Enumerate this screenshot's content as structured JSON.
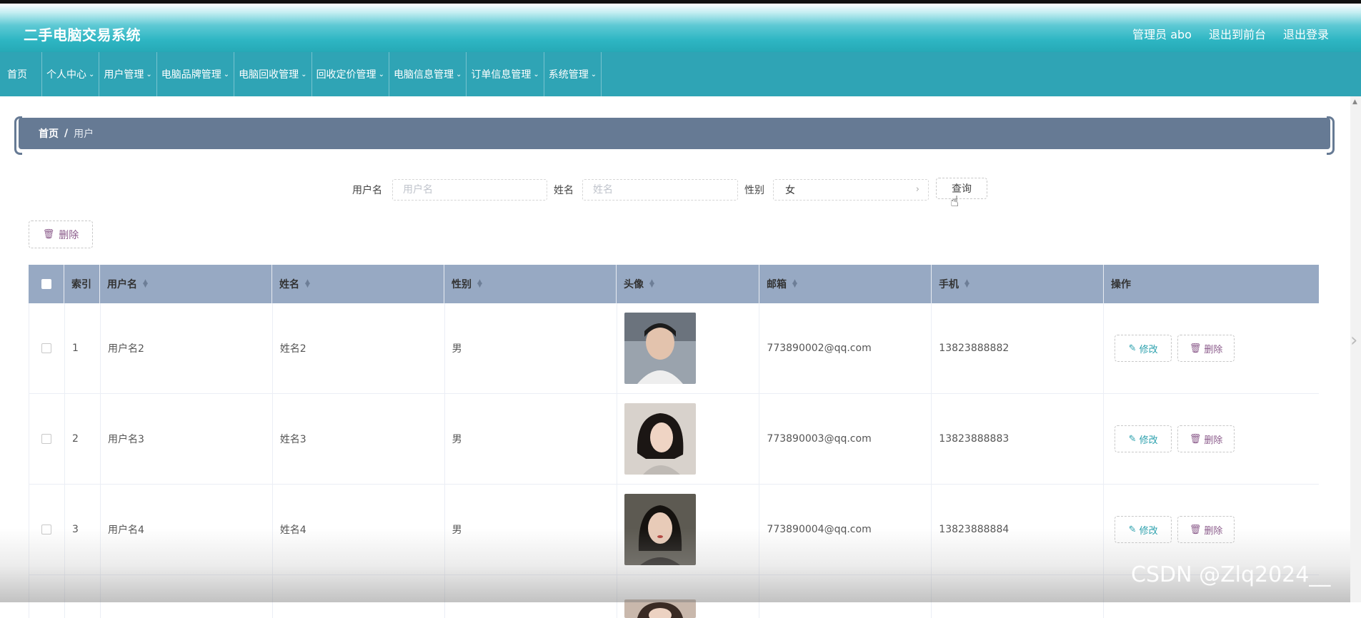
{
  "header": {
    "app_title": "二手电脑交易系统",
    "admin_label": "管理员 abo",
    "front_link": "退出到前台",
    "logout_link": "退出登录"
  },
  "nav": {
    "items": [
      {
        "label": "首页"
      },
      {
        "label": "个人中心"
      },
      {
        "label": "用户管理"
      },
      {
        "label": "电脑品牌管理"
      },
      {
        "label": "电脑回收管理"
      },
      {
        "label": "回收定价管理"
      },
      {
        "label": "电脑信息管理"
      },
      {
        "label": "订单信息管理"
      },
      {
        "label": "系统管理"
      }
    ]
  },
  "breadcrumb": {
    "home": "首页",
    "separator": "/",
    "current": "用户"
  },
  "search": {
    "username_label": "用户名",
    "username_placeholder": "用户名",
    "name_label": "姓名",
    "name_placeholder": "姓名",
    "gender_label": "性别",
    "gender_value": "女",
    "query_button": "查询"
  },
  "toolbar": {
    "delete_label": "删除"
  },
  "table": {
    "columns": [
      "索引",
      "用户名",
      "姓名",
      "性别",
      "头像",
      "邮箱",
      "手机",
      "操作"
    ],
    "edit_label": "修改",
    "delete_label": "删除",
    "rows": [
      {
        "index": "1",
        "username": "用户名2",
        "name": "姓名2",
        "gender": "男",
        "email": "773890002@qq.com",
        "phone": "13823888882"
      },
      {
        "index": "2",
        "username": "用户名3",
        "name": "姓名3",
        "gender": "男",
        "email": "773890003@qq.com",
        "phone": "13823888883"
      },
      {
        "index": "3",
        "username": "用户名4",
        "name": "姓名4",
        "gender": "男",
        "email": "773890004@qq.com",
        "phone": "13823888884"
      }
    ]
  },
  "watermark": "CSDN @Zlq2024__",
  "colors": {
    "header_teal": "#2eb6c3",
    "nav_teal": "#2fa4b5",
    "breadcrumb_slate": "#667a94",
    "table_header": "#97a9c3",
    "edit_accent": "#2aa0ad",
    "delete_accent": "#8a5a8a"
  }
}
